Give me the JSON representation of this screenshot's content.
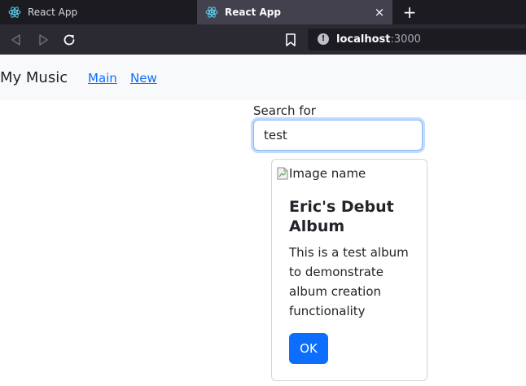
{
  "browser": {
    "tabs": [
      {
        "title": "React App",
        "icon": "react-icon",
        "active": false
      },
      {
        "title": "React App",
        "icon": "react-icon",
        "active": true
      }
    ],
    "close_tab_glyph": "×",
    "new_tab_glyph": "+",
    "url": {
      "host": "localhost",
      "port": ":3000"
    },
    "info_glyph": "!"
  },
  "app": {
    "brand": "My Music",
    "nav_links": [
      "Main",
      "New"
    ],
    "search": {
      "label": "Search for",
      "value": "test"
    },
    "album_card": {
      "image_alt": "Image name",
      "title": "Eric's Debut Album",
      "description": "This is a test album to demonstrate album creation functionality",
      "button_label": "OK"
    }
  },
  "colors": {
    "primary": "#0d6efd",
    "navbar_bg": "#f8f9fa",
    "browser_dark": "#1c1b22",
    "active_tab": "#42414d"
  }
}
